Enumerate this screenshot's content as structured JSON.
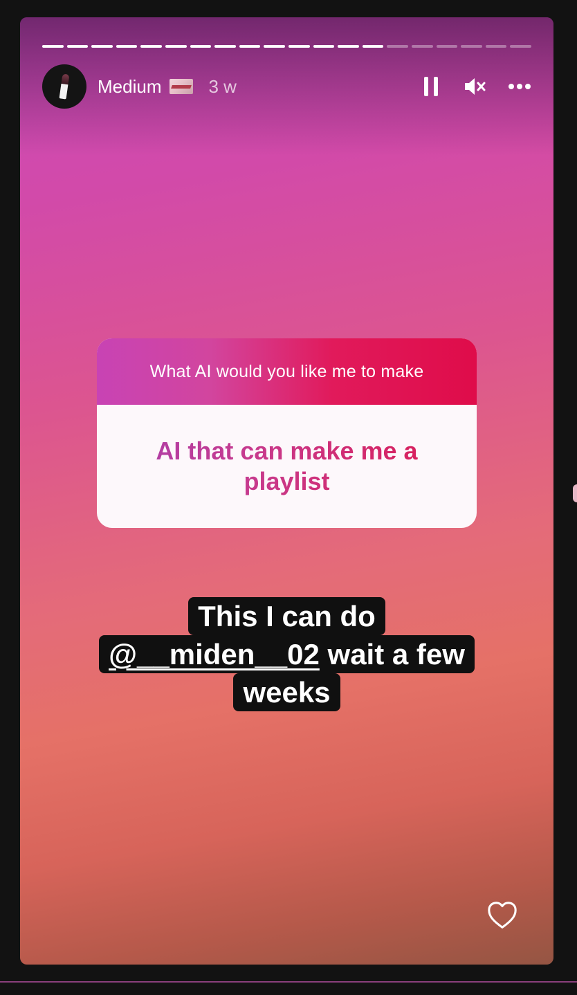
{
  "story": {
    "progress": {
      "segments_total": 20,
      "segments_done": 14
    },
    "header": {
      "username": "Medium",
      "timestamp": "3 w",
      "icons": [
        "pause-icon",
        "muted-speaker-icon",
        "more-options-icon"
      ]
    },
    "question_sticker": {
      "question": "What AI would you like me to make",
      "answer": "AI that can make me a playlist"
    },
    "caption": {
      "line1": "This I can do",
      "mention": "@__miden__02",
      "line2_rest": " wait a few",
      "line3": "weeks"
    },
    "like_icon": "heart-icon"
  },
  "colors": {
    "background": "#121212",
    "gradient_top": "#cc4cba",
    "gradient_bottom": "#955543",
    "sticker_accent": "#df0c4a"
  }
}
